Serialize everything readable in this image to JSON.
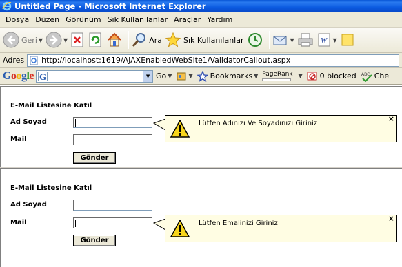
{
  "window": {
    "title": "Untitled Page - Microsoft Internet Explorer"
  },
  "menu": {
    "items": [
      "Dosya",
      "Düzen",
      "Görünüm",
      "Sık Kullanılanlar",
      "Araçlar",
      "Yardım"
    ]
  },
  "toolbar": {
    "back_label": "Geri",
    "search_label": "Ara",
    "favorites_label": "Sık Kullanılanlar"
  },
  "address": {
    "label": "Adres",
    "url": "http://localhost:1619/AJAXEnabledWebSite1/ValidatorCallout.aspx"
  },
  "google_toolbar": {
    "logo": "Google",
    "go_label": "Go",
    "bookmarks_label": "Bookmarks",
    "pagerank_label": "PageRank",
    "blocked_label": "0 blocked",
    "check_label": "Che",
    "abc_label": "ABC"
  },
  "forms": [
    {
      "title": "E-Mail Listesine Katıl",
      "name_label": "Ad Soyad",
      "mail_label": "Mail",
      "name_value": "",
      "mail_value": "",
      "submit_label": "Gönder",
      "callout_message": "Lütfen Adınızı Ve Soyadınızı Giriniz",
      "callout_close": "×"
    },
    {
      "title": "E-Mail Listesine Katıl",
      "name_label": "Ad Soyad",
      "mail_label": "Mail",
      "name_value": "",
      "mail_value": "",
      "submit_label": "Gönder",
      "callout_message": "Lütfen Emalinizi Giriniz",
      "callout_close": "×"
    }
  ],
  "colors": {
    "titlebar": "#0a58d8",
    "chrome": "#ece9d8",
    "callout_bg": "#fffde3",
    "warning_yellow": "#f7d51b"
  }
}
